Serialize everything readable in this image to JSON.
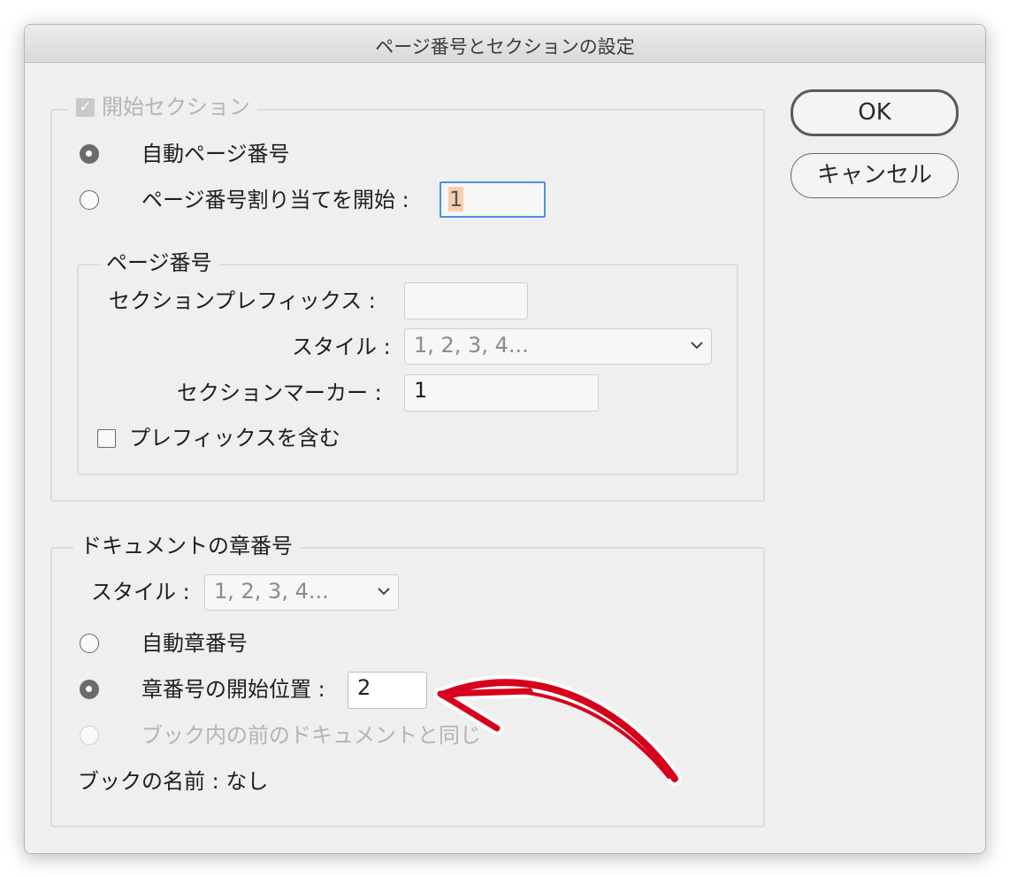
{
  "window": {
    "title": "ページ番号とセクションの設定"
  },
  "buttons": {
    "ok": "OK",
    "cancel": "キャンセル"
  },
  "start_section": {
    "label": "開始セクション",
    "checked": true,
    "enabled": false,
    "auto_page_numbering": "自動ページ番号",
    "start_page_numbering": "ページ番号割り当てを開始 :",
    "start_page_value": "1",
    "selected": "auto_page_numbering"
  },
  "page_numbering": {
    "legend": "ページ番号",
    "section_prefix_label": "セクションプレフィックス :",
    "section_prefix_value": "",
    "style_label": "スタイル :",
    "style_value": "1, 2, 3, 4...",
    "section_marker_label": "セクションマーカー :",
    "section_marker_value": "1",
    "include_prefix_label": "プレフィックスを含む",
    "include_prefix_checked": false
  },
  "chapter_numbering": {
    "legend": "ドキュメントの章番号",
    "style_label": "スタイル :",
    "style_value": "1, 2, 3, 4...",
    "auto_chapter": "自動章番号",
    "start_chapter": "章番号の開始位置 :",
    "start_chapter_value": "2",
    "same_as_previous": "ブック内の前のドキュメントと同じ",
    "selected": "start_chapter",
    "book_name": "ブックの名前 : なし"
  },
  "annotation": {
    "arrow_color": "#d6001c"
  }
}
